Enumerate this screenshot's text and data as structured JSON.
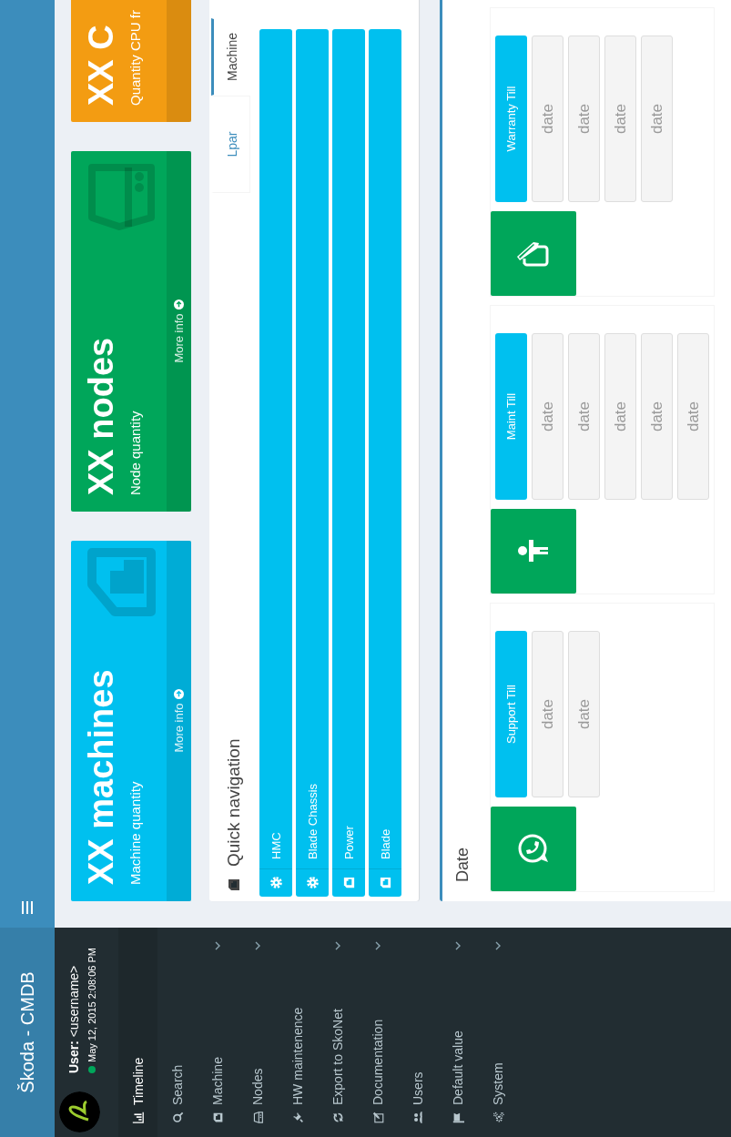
{
  "header": {
    "logo": "Škoda - CMDB"
  },
  "user": {
    "name": "**User:** <username>",
    "online": true,
    "timestamp": "May 12, 2015 2:08:06 PM"
  },
  "sidebar": {
    "items": [
      {
        "label": "Timeline",
        "selected": true,
        "expandable": false
      },
      {
        "label": "Search",
        "selected": false,
        "expandable": false
      },
      {
        "label": "Machine",
        "selected": false,
        "expandable": true
      },
      {
        "label": "Nodes",
        "selected": false,
        "expandable": true
      },
      {
        "label": "HW maintenence",
        "selected": false,
        "expandable": false
      },
      {
        "label": "Export to SkoNet",
        "selected": false,
        "expandable": true
      },
      {
        "label": "Documentation",
        "selected": false,
        "expandable": true
      },
      {
        "label": "Users",
        "selected": false,
        "expandable": false
      },
      {
        "label": "Default value",
        "selected": false,
        "expandable": true
      },
      {
        "label": "System",
        "selected": false,
        "expandable": true
      }
    ]
  },
  "stats": [
    {
      "title": "XX machines",
      "subtitle": "Machine quantity",
      "link": "More info",
      "color": "#00c0ef"
    },
    {
      "title": "XX nodes",
      "subtitle": "Node quantity",
      "link": "More info",
      "color": "#00a65a"
    },
    {
      "title": "XX C",
      "subtitle": "Quantity CPU fr",
      "color": "#f39c12"
    }
  ],
  "quick_navigation": {
    "title": "Quick navigation",
    "tabs": [
      {
        "label": "Lpar",
        "selected": false
      },
      {
        "label": "Machine",
        "selected": true
      }
    ],
    "items": [
      {
        "label": "HMC"
      },
      {
        "label": "Blade Chassis"
      },
      {
        "label": "Power"
      },
      {
        "label": "Blade"
      }
    ]
  },
  "date_box": {
    "title": "Date",
    "panels": [
      {
        "header": "Support Till",
        "cells": [
          "date",
          "date"
        ]
      },
      {
        "header": "Maint Till",
        "cells": [
          "date",
          "date",
          "date",
          "date",
          "date"
        ]
      },
      {
        "header": "Warranty Till",
        "cells": [
          "date",
          "date",
          "date",
          "date"
        ]
      }
    ]
  }
}
